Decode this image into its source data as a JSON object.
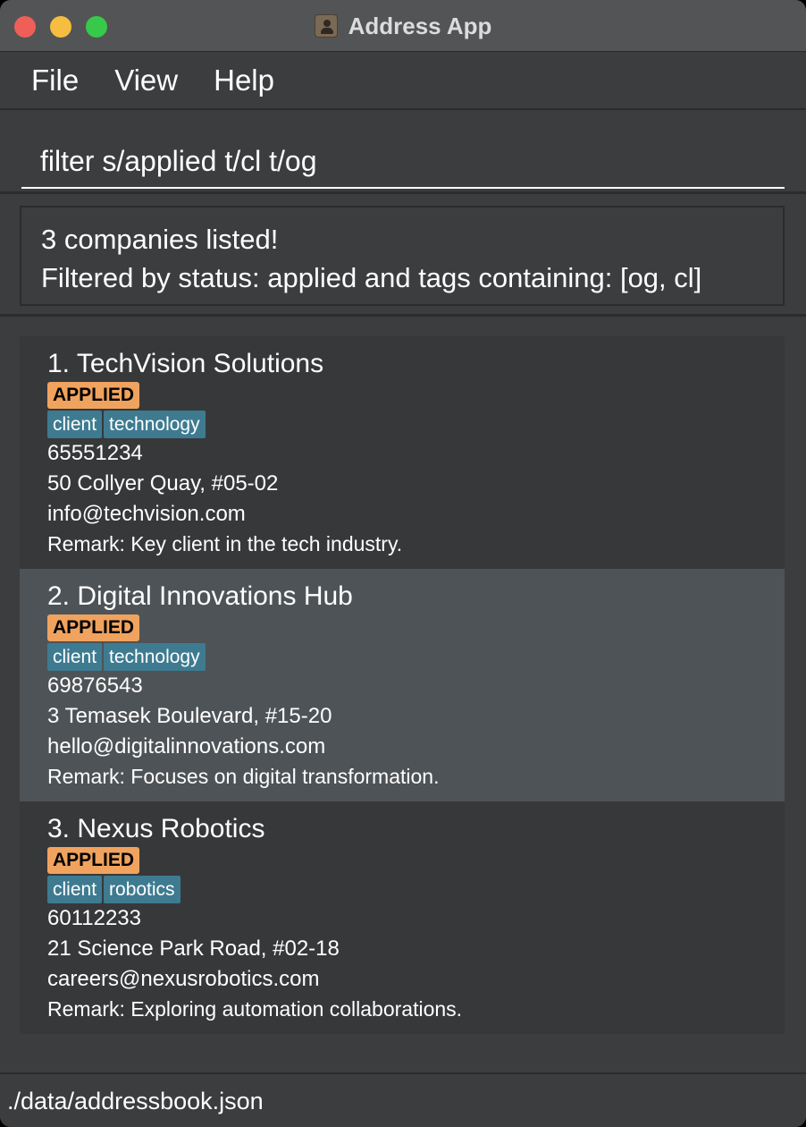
{
  "window": {
    "title": "Address App"
  },
  "menu": {
    "file": "File",
    "view": "View",
    "help": "Help"
  },
  "command": {
    "value": "filter s/applied t/cl t/og"
  },
  "result": {
    "line1": "3 companies listed!",
    "line2": "Filtered by status: applied and tags containing: [og, cl]"
  },
  "companies": [
    {
      "title": "1. TechVision Solutions",
      "status": "APPLIED",
      "tags": [
        "client",
        "technology"
      ],
      "phone": "65551234",
      "address": "50 Collyer Quay, #05-02",
      "email": "info@techvision.com",
      "remark": "Remark: Key client in the tech industry."
    },
    {
      "title": "2. Digital Innovations Hub",
      "status": "APPLIED",
      "tags": [
        "client",
        "technology"
      ],
      "phone": "69876543",
      "address": "3 Temasek Boulevard, #15-20",
      "email": "hello@digitalinnovations.com",
      "remark": "Remark: Focuses on digital transformation."
    },
    {
      "title": "3. Nexus Robotics",
      "status": "APPLIED",
      "tags": [
        "client",
        "robotics"
      ],
      "phone": "60112233",
      "address": "21 Science Park Road, #02-18",
      "email": "careers@nexusrobotics.com",
      "remark": "Remark: Exploring automation collaborations."
    }
  ],
  "selected_index": 1,
  "statusbar": {
    "path": "./data/addressbook.json"
  },
  "colors": {
    "status_badge": "#f0a35e",
    "tag": "#3e7b91",
    "selected_card": "#4e5357",
    "background": "#3c3d3f"
  },
  "icons": [
    "close-window-icon",
    "minimize-window-icon",
    "maximize-window-icon",
    "address-app-icon"
  ]
}
